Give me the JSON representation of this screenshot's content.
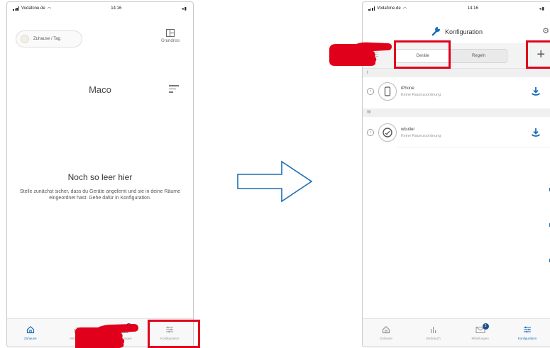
{
  "left_screen": {
    "status": {
      "carrier": "Vodafone.de",
      "time": "14:16"
    },
    "home_chip": "Zuhause / Tag",
    "floorplan_label": "Grundriss",
    "room_title": "Maco",
    "empty_title": "Noch so leer hier",
    "empty_text": "Stelle zunächst sicher, dass du Geräte angelernt und sie in deine Räume eingeordnet hast. Gehe dafür in Konfiguration.",
    "tabs": [
      {
        "label": "Zuhause",
        "icon": "home-icon",
        "active": true
      },
      {
        "label": "Verbrauch",
        "icon": "chart-icon",
        "active": false
      },
      {
        "label": "Mitteilungen",
        "icon": "mail-icon",
        "active": false,
        "badge": "3"
      },
      {
        "label": "Konfiguration",
        "icon": "sliders-icon",
        "active": false
      }
    ]
  },
  "right_screen": {
    "status": {
      "carrier": "Vodafone.de",
      "time": "14:16"
    },
    "title": "Konfiguration",
    "segments": [
      {
        "label": "Geräte",
        "active": true
      },
      {
        "label": "Regeln",
        "active": false
      }
    ],
    "sections": [
      {
        "letter": "I",
        "device": {
          "name": "iPhone",
          "subtitle": "Keine Raumzuordnung",
          "icon": "phone-icon"
        }
      },
      {
        "letter": "W",
        "device": {
          "name": "wbutler",
          "subtitle": "Keine Raumzuordnung",
          "icon": "gauge-icon"
        }
      }
    ],
    "tabs": [
      {
        "label": "Zuhause",
        "icon": "home-icon"
      },
      {
        "label": "Verbrauch",
        "icon": "chart-icon"
      },
      {
        "label": "Mitteilungen",
        "icon": "mail-icon",
        "badge": "3"
      },
      {
        "label": "Konfiguration",
        "icon": "sliders-icon",
        "active": true
      }
    ]
  },
  "colors": {
    "highlight": "#e0001b",
    "accent": "#1b6fb5",
    "arrow": "#1b6fb5"
  }
}
